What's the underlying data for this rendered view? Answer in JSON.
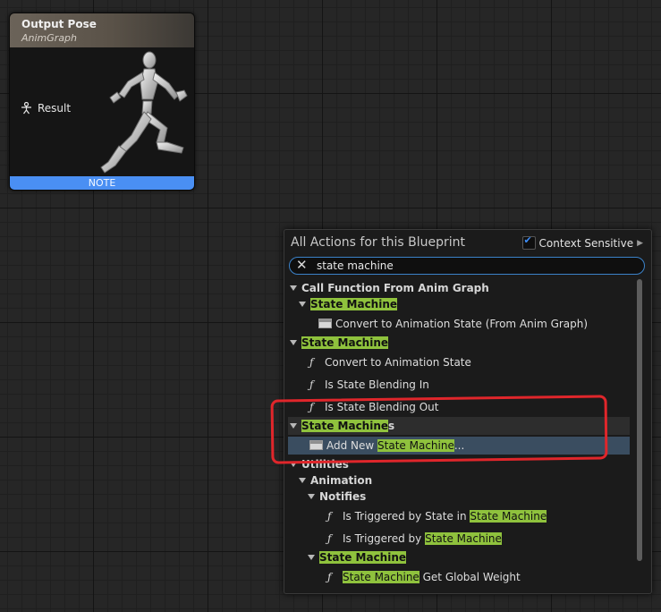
{
  "node": {
    "title": "Output Pose",
    "subtitle": "AnimGraph",
    "pin_label": "Result",
    "footer": "NOTE"
  },
  "menu": {
    "title": "All Actions for this Blueprint",
    "context_label": "Context Sensitive",
    "context_checked": true,
    "search_value": "state machine",
    "accent_color": "#8fc23d",
    "items": [
      {
        "kind": "category",
        "pre": "Call Function From Anim Graph",
        "hl": "",
        "post": ""
      },
      {
        "kind": "category",
        "pre": "",
        "hl": "State Machine",
        "post": ""
      },
      {
        "kind": "action",
        "icon": "window-icon",
        "pre": "Convert to Animation State (From Anim Graph)",
        "hl": "",
        "post": ""
      },
      {
        "kind": "category",
        "pre": "",
        "hl": "State Machine",
        "post": ""
      },
      {
        "kind": "action",
        "icon": "function-icon",
        "pre": "Convert to Animation State",
        "hl": "",
        "post": ""
      },
      {
        "kind": "action",
        "icon": "function-icon",
        "pre": "Is State Blending In",
        "hl": "",
        "post": ""
      },
      {
        "kind": "action",
        "icon": "function-icon",
        "pre": "Is State Blending Out",
        "hl": "",
        "post": ""
      },
      {
        "kind": "category",
        "pre": "",
        "hl": "State Machine",
        "post": "s"
      },
      {
        "kind": "action",
        "icon": "window-icon",
        "pre": "Add New ",
        "hl": "State Machine",
        "post": "..."
      },
      {
        "kind": "category",
        "pre": "Utilities",
        "hl": "",
        "post": ""
      },
      {
        "kind": "category",
        "pre": "Animation",
        "hl": "",
        "post": ""
      },
      {
        "kind": "category",
        "pre": "Notifies",
        "hl": "",
        "post": ""
      },
      {
        "kind": "action",
        "icon": "function-icon",
        "pre": "Is Triggered by State in ",
        "hl": "State Machine",
        "post": ""
      },
      {
        "kind": "action",
        "icon": "function-icon",
        "pre": "Is Triggered by ",
        "hl": "State Machine",
        "post": ""
      },
      {
        "kind": "category",
        "pre": "",
        "hl": "State Machine",
        "post": ""
      },
      {
        "kind": "action",
        "icon": "function-icon",
        "pre": "",
        "hl": "State Machine",
        "post": " Get Global Weight"
      }
    ]
  }
}
